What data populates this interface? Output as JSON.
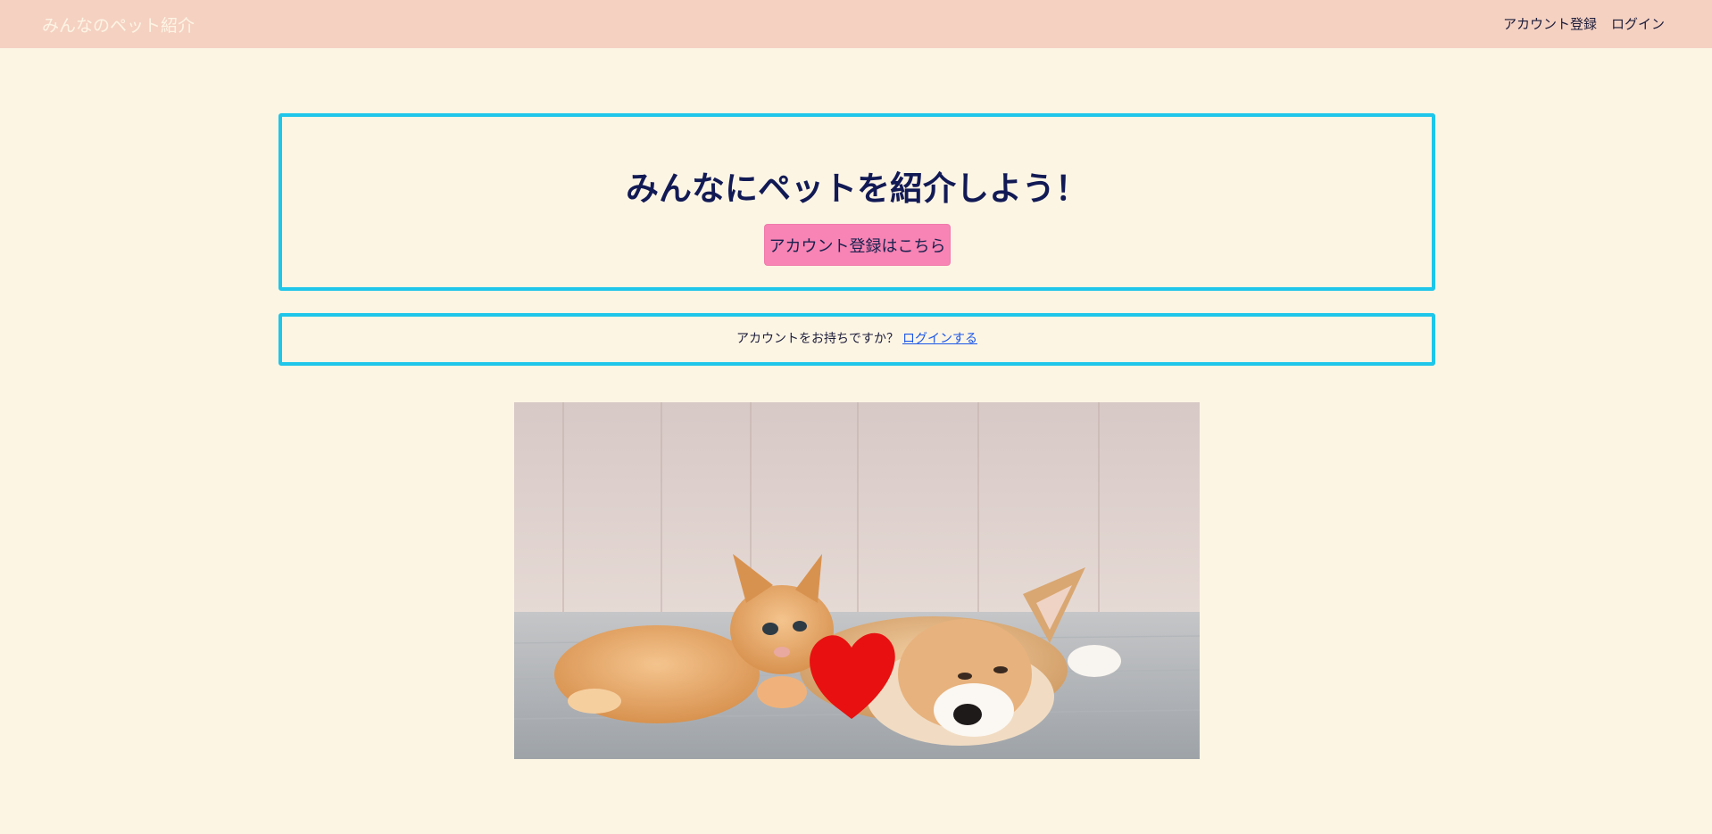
{
  "nav": {
    "brand": "みんなのペット紹介",
    "links": [
      "アカウント登録",
      "ログイン"
    ]
  },
  "hero": {
    "title": "みんなにペットを紹介しよう！",
    "signup_button": "アカウント登録はこちら"
  },
  "login_prompt": {
    "text": "アカウントをお持ちですか？",
    "link": "ログインする"
  },
  "colors": {
    "page_background": "#fdf5e4",
    "navbar": "#f5d1c2",
    "card_border": "#1ec6ea",
    "button": "#f784b4",
    "title": "#121a55",
    "link": "#1a56e8"
  }
}
